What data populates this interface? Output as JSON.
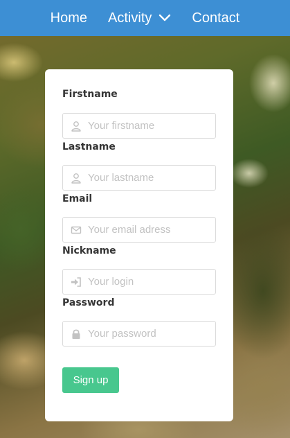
{
  "nav": {
    "home": "Home",
    "activity": "Activity",
    "contact": "Contact"
  },
  "form": {
    "fields": [
      {
        "label": "Firstname",
        "placeholder": "Your firstname",
        "icon": "user-icon"
      },
      {
        "label": "Lastname",
        "placeholder": "Your lastname",
        "icon": "user-icon"
      },
      {
        "label": "Email",
        "placeholder": "Your email adress",
        "icon": "envelope-icon"
      },
      {
        "label": "Nickname",
        "placeholder": "Your login",
        "icon": "sign-in-icon"
      },
      {
        "label": "Password",
        "placeholder": "Your password",
        "icon": "lock-icon"
      }
    ],
    "submit_label": "Sign up"
  },
  "colors": {
    "navbar": "#3d8fd4",
    "button": "#48c78e",
    "icon": "#c2c2c2"
  }
}
